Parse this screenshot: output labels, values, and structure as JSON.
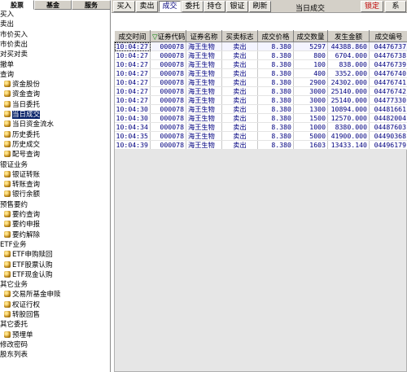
{
  "left_tabs": [
    "股票",
    "基金",
    "服务"
  ],
  "tree": [
    {
      "label": "买入",
      "indent": 0
    },
    {
      "label": "卖出",
      "indent": 0
    },
    {
      "label": "市价买入",
      "indent": 0
    },
    {
      "label": "市价卖出",
      "indent": 0
    },
    {
      "label": "对买对卖",
      "indent": 0
    },
    {
      "label": "撤单",
      "indent": 0
    },
    {
      "label": "查询",
      "indent": 0
    },
    {
      "label": "资金股份",
      "indent": 1
    },
    {
      "label": "资金查询",
      "indent": 1
    },
    {
      "label": "当日委托",
      "indent": 1
    },
    {
      "label": "当日成交",
      "indent": 1,
      "selected": true
    },
    {
      "label": "当日资金流水",
      "indent": 1
    },
    {
      "label": "历史委托",
      "indent": 1
    },
    {
      "label": "历史成交",
      "indent": 1
    },
    {
      "label": "配号查询",
      "indent": 1
    },
    {
      "label": "银证业务",
      "indent": 0
    },
    {
      "label": "银证转账",
      "indent": 1
    },
    {
      "label": "转账查询",
      "indent": 1
    },
    {
      "label": "银行余额",
      "indent": 1
    },
    {
      "label": "预售要约",
      "indent": 0
    },
    {
      "label": "要约查询",
      "indent": 1
    },
    {
      "label": "要约申报",
      "indent": 1
    },
    {
      "label": "要约解除",
      "indent": 1
    },
    {
      "label": "ETF业务",
      "indent": 0
    },
    {
      "label": "ETF申购赎回",
      "indent": 1
    },
    {
      "label": "ETF股票认购",
      "indent": 1
    },
    {
      "label": "ETF现金认购",
      "indent": 1
    },
    {
      "label": "其它业务",
      "indent": 0
    },
    {
      "label": "交易所基金申赎",
      "indent": 1
    },
    {
      "label": "权证行权",
      "indent": 1
    },
    {
      "label": "转股回售",
      "indent": 1
    },
    {
      "label": "其它委托",
      "indent": 0
    },
    {
      "label": "预埋单",
      "indent": 1
    },
    {
      "label": "修改密码",
      "indent": 0
    },
    {
      "label": "股东列表",
      "indent": 0
    }
  ],
  "toolbar": {
    "buttons": [
      "买入",
      "卖出",
      "成交",
      "委托",
      "持仓",
      "银证",
      "刷新"
    ],
    "title": "当日成交",
    "lock": "锁定",
    "sys": "系"
  },
  "columns": [
    "成交时间",
    "证券代码",
    "证券名称",
    "买卖标志",
    "成交价格",
    "成交数量",
    "发生金额",
    "成交编号"
  ],
  "sort_marker": "▽",
  "rows": [
    [
      "10:04:27",
      "000078",
      "海王生物",
      "卖出",
      "8.380",
      "5297",
      "44388.860",
      "04476737"
    ],
    [
      "10:04:27",
      "000078",
      "海王生物",
      "卖出",
      "8.380",
      "800",
      "6704.000",
      "04476738"
    ],
    [
      "10:04:27",
      "000078",
      "海王生物",
      "卖出",
      "8.380",
      "100",
      "838.000",
      "04476739"
    ],
    [
      "10:04:27",
      "000078",
      "海王生物",
      "卖出",
      "8.380",
      "400",
      "3352.000",
      "04476740"
    ],
    [
      "10:04:27",
      "000078",
      "海王生物",
      "卖出",
      "8.380",
      "2900",
      "24302.000",
      "04476741"
    ],
    [
      "10:04:27",
      "000078",
      "海王生物",
      "卖出",
      "8.380",
      "3000",
      "25140.000",
      "04476742"
    ],
    [
      "10:04:27",
      "000078",
      "海王生物",
      "卖出",
      "8.380",
      "3000",
      "25140.000",
      "04477330"
    ],
    [
      "10:04:30",
      "000078",
      "海王生物",
      "卖出",
      "8.380",
      "1300",
      "10894.000",
      "04481661"
    ],
    [
      "10:04:30",
      "000078",
      "海王生物",
      "卖出",
      "8.380",
      "1500",
      "12570.000",
      "04482004"
    ],
    [
      "10:04:34",
      "000078",
      "海王生物",
      "卖出",
      "8.380",
      "1000",
      "8380.000",
      "04487603"
    ],
    [
      "10:04:35",
      "000078",
      "海王生物",
      "卖出",
      "8.380",
      "5000",
      "41900.000",
      "04490368"
    ],
    [
      "10:04:39",
      "000078",
      "海王生物",
      "卖出",
      "8.380",
      "1603",
      "13433.140",
      "04496179"
    ]
  ]
}
